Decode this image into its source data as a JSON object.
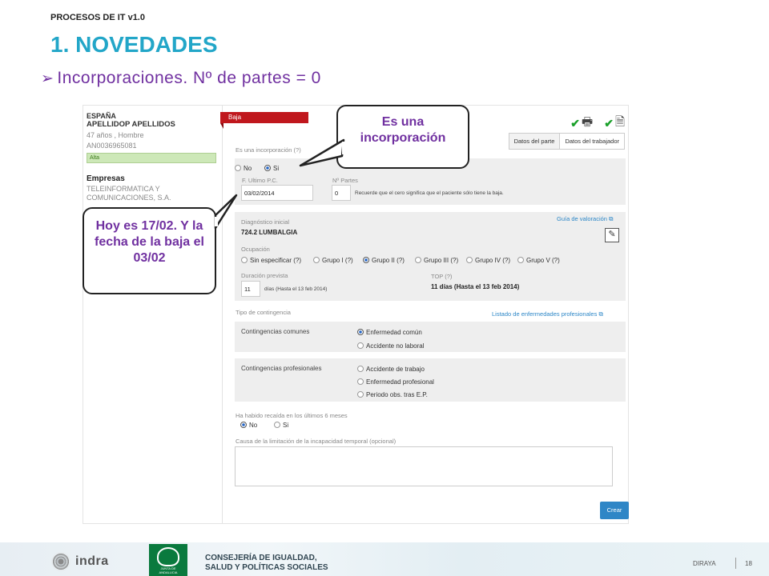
{
  "doc_title": "PROCESOS DE IT v1.0",
  "section_title": "1. NOVEDADES",
  "bullet": "Incorporaciones. Nº de partes = 0",
  "patient": {
    "country": "ESPAÑA",
    "name": "APELLIDOP APELLIDOS",
    "age_sex": "47 años , Hombre",
    "id": "AN0036965081",
    "status": "Alta",
    "companies_label": "Empresas",
    "companies_value": "TELEINFORMATICA Y COMUNICACIONES, S.A."
  },
  "form": {
    "tab_label": "Baja",
    "view_tabs": [
      "Datos del parte",
      "Datos del trabajador"
    ],
    "incorporation_label": "Es una incorporación (?)",
    "opt_no": "No",
    "opt_si": "Si",
    "last_pc_label": "F. Ultimo P.C.",
    "last_pc_value": "03/02/2014",
    "parts_label": "Nº Partes",
    "parts_value": "0",
    "parts_note": "Recuerde que el cero significa que el paciente sólo tiene la baja.",
    "diag_label": "Diagnóstico inicial",
    "diag_value": "724.2 LUMBALGIA",
    "guide_link": "Guía de valoración",
    "occupation_label": "Ocupación",
    "occupation_opts": [
      "Sin especificar (?)",
      "Grupo I (?)",
      "Grupo II (?)",
      "Grupo III (?)",
      "Grupo IV (?)",
      "Grupo V (?)"
    ],
    "duration_label": "Duración prevista",
    "duration_value": "11",
    "duration_note": "días (Hasta el 13 feb 2014)",
    "top_label": "TOP (?)",
    "top_value": "11 días (Hasta el 13 feb 2014)",
    "contingency_label": "Tipo de contingencia",
    "diseases_link": "Listado de enfermedades profesionales",
    "common_label": "Contingencias comunes",
    "common_opts": [
      "Enfermedad común",
      "Accidente no laboral"
    ],
    "prof_label": "Contingencias profesionales",
    "prof_opts": [
      "Accidente de trabajo",
      "Enfermedad profesional",
      "Periodo obs. tras E.P."
    ],
    "relapse_label": "Ha habido recaída en los últimos 6 meses",
    "relapse_no": "No",
    "relapse_si": "Si",
    "cause_label": "Causa de la limitación de la incapacidad temporal (opcional)",
    "create_button": "Crear"
  },
  "callouts": {
    "incorporation": "Es una incorporación",
    "date_note": "Hoy es 17/02. Y la fecha de la baja el 03/02"
  },
  "footer": {
    "indra": "indra",
    "junta": "JUNTA DE ANDALUCIA",
    "consejeria_line1": "CONSEJERÍA DE IGUALDAD,",
    "consejeria_line2": "SALUD Y POLÍTICAS SOCIALES",
    "app": "DIRAYA",
    "page": "18"
  }
}
